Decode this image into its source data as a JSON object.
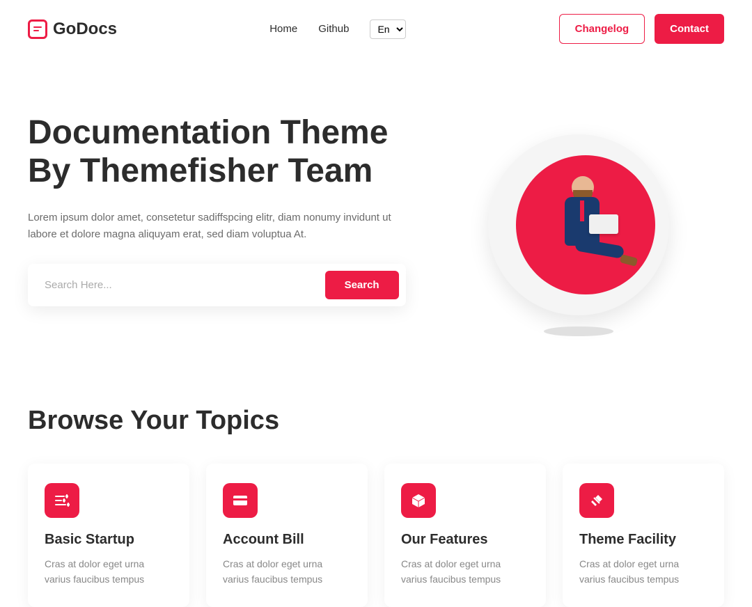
{
  "brand": {
    "name": "GoDocs"
  },
  "nav": {
    "links": [
      {
        "label": "Home"
      },
      {
        "label": "Github"
      }
    ],
    "lang_selected": "En"
  },
  "header_actions": {
    "changelog": "Changelog",
    "contact": "Contact"
  },
  "hero": {
    "title": "Documentation Theme By Themefisher Team",
    "description": "Lorem ipsum dolor amet, consetetur sadiffspcing elitr, diam nonumy invidunt ut labore et dolore magna aliquyam erat, sed diam voluptua At.",
    "search_placeholder": "Search Here...",
    "search_button": "Search"
  },
  "topics": {
    "heading": "Browse Your Topics",
    "cards": [
      {
        "icon": "sliders-icon",
        "title": "Basic Startup",
        "desc": "Cras at dolor eget urna varius faucibus tempus"
      },
      {
        "icon": "card-icon",
        "title": "Account Bill",
        "desc": "Cras at dolor eget urna varius faucibus tempus"
      },
      {
        "icon": "box-icon",
        "title": "Our Features",
        "desc": "Cras at dolor eget urna varius faucibus tempus"
      },
      {
        "icon": "tools-icon",
        "title": "Theme Facility",
        "desc": "Cras at dolor eget urna varius faucibus tempus"
      }
    ]
  },
  "colors": {
    "primary": "#ed1c45"
  }
}
